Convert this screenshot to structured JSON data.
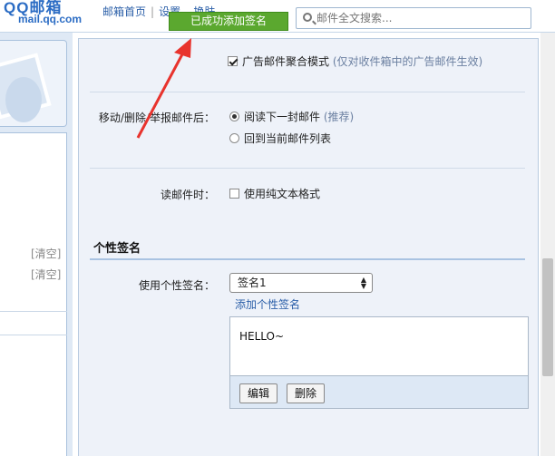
{
  "header": {
    "logo_text": "QQ邮箱",
    "logo_domain": "mail.qq.com",
    "links": [
      "邮箱首页",
      "设置",
      "换肤"
    ],
    "search_placeholder": "邮件全文搜索..."
  },
  "toast": "已成功添加签名",
  "left": {
    "clear_label": "[清空]"
  },
  "settings": {
    "ad_mode": {
      "label": "广告邮件聚合模式",
      "hint": "(仅对收件箱中的广告邮件生效)",
      "checked": true
    },
    "after_action": {
      "label": "移动/删除/举报邮件后：",
      "options": [
        {
          "text": "阅读下一封邮件",
          "hint": "(推荐)",
          "selected": true
        },
        {
          "text": "回到当前邮件列表",
          "hint": "",
          "selected": false
        }
      ]
    },
    "read_mail": {
      "label": "读邮件时：",
      "option": "使用纯文本格式",
      "checked": false
    }
  },
  "signature": {
    "section_title": "个性签名",
    "use_label": "使用个性签名：",
    "selected": "签名1",
    "add_link": "添加个性签名",
    "content": "HELLO~",
    "edit_button": "编辑",
    "delete_button": "删除"
  },
  "colors": {
    "toast_bg": "#5ba82f",
    "link": "#2b5fa8",
    "panel_bg": "#eef2f9",
    "arrow": "#e8332d"
  }
}
